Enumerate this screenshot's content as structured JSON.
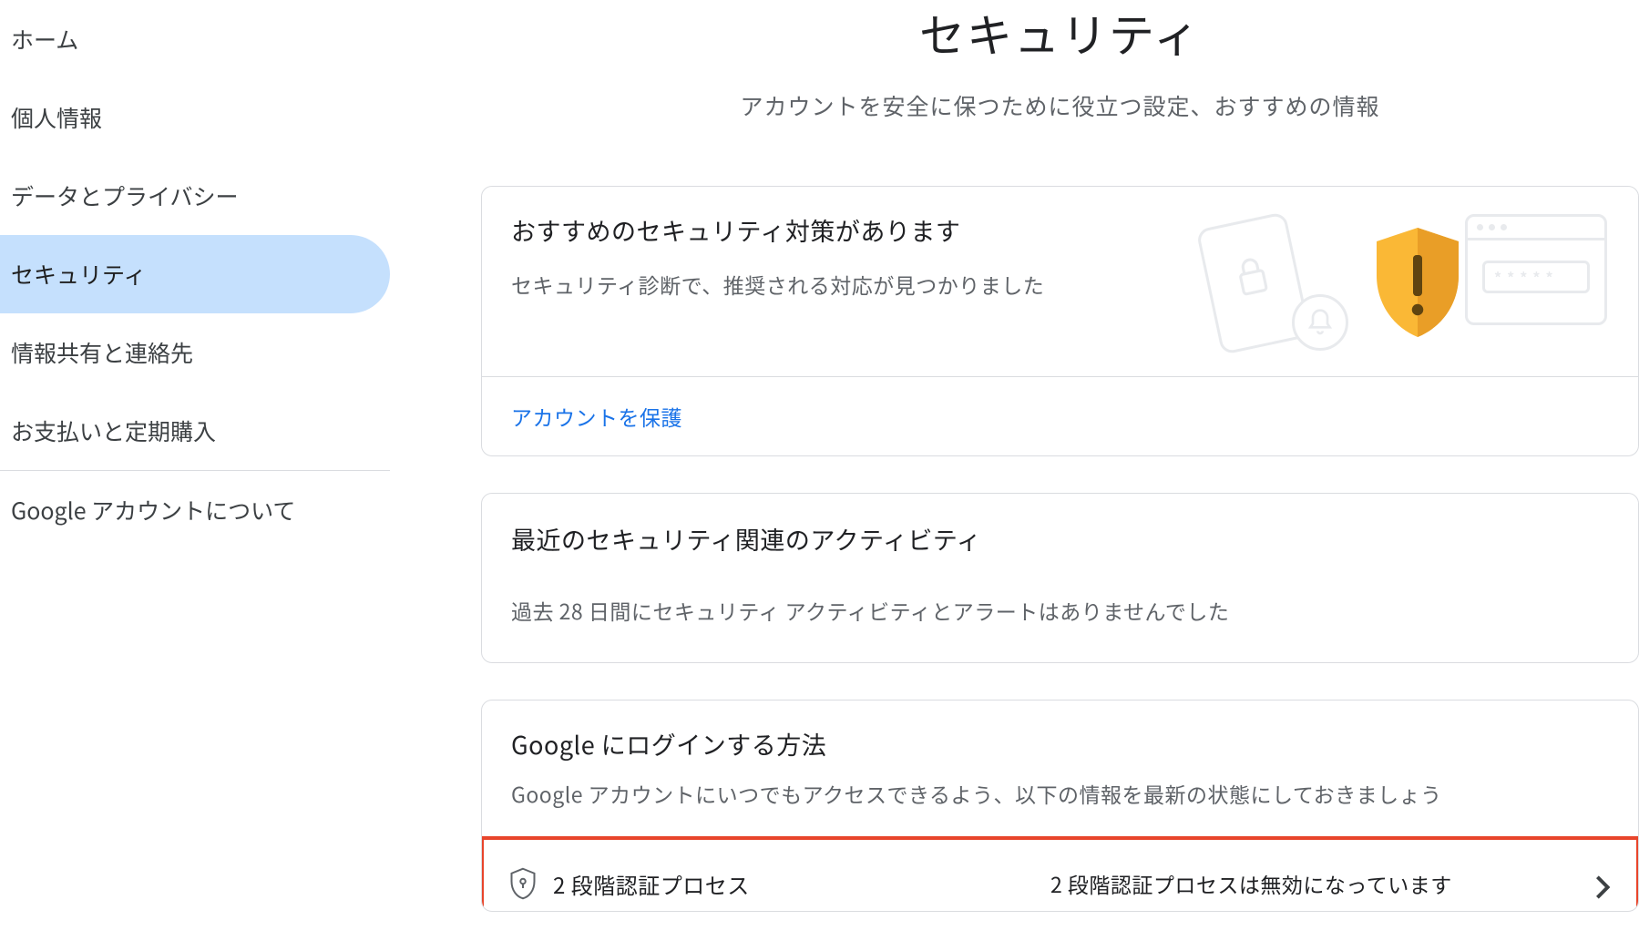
{
  "sidebar": {
    "items": [
      {
        "label": "ホーム"
      },
      {
        "label": "個人情報"
      },
      {
        "label": "データとプライバシー"
      },
      {
        "label": "セキュリティ"
      },
      {
        "label": "情報共有と連絡先"
      },
      {
        "label": "お支払いと定期購入"
      }
    ],
    "about": "Google アカウントについて"
  },
  "header": {
    "title": "セキュリティ",
    "subtitle": "アカウントを安全に保つために役立つ設定、おすすめの情報"
  },
  "recommendation": {
    "title": "おすすめのセキュリティ対策があります",
    "description": "セキュリティ診断で、推奨される対応が見つかりました",
    "action": "アカウントを保護"
  },
  "activity": {
    "title": "最近のセキュリティ関連のアクティビティ",
    "description": "過去 28 日間にセキュリティ アクティビティとアラートはありませんでした"
  },
  "login_methods": {
    "title": "Google にログインする方法",
    "description": "Google アカウントにいつでもアクセスできるよう、以下の情報を最新の状態にしておきましょう",
    "two_step": {
      "label": "2 段階認証プロセス",
      "status": "2 段階認証プロセスは無効になっています"
    }
  }
}
